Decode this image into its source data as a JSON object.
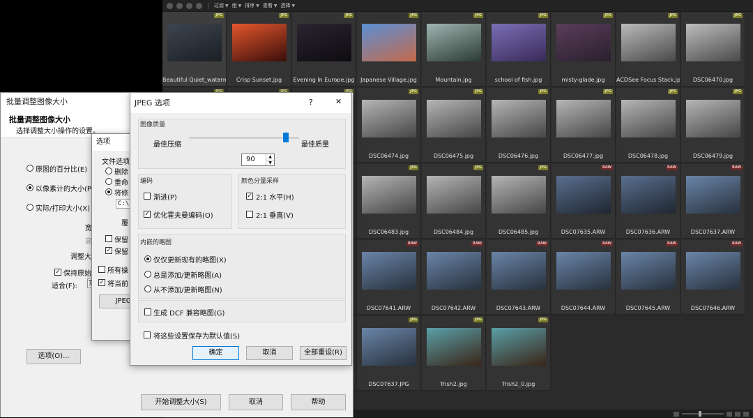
{
  "browser": {
    "toolbar": [
      "过滤",
      "组",
      "排序",
      "查看",
      "选择"
    ],
    "files": [
      {
        "name": "Beautiful Quiet_waterm...",
        "badge": "JPG",
        "c1": "#3d4550",
        "c2": "#1a1f24"
      },
      {
        "name": "Crisp Sunset.jpg",
        "badge": "JPG",
        "c1": "#e4572e",
        "c2": "#3a0e0a"
      },
      {
        "name": "Evening In Europe.jpg",
        "badge": "JPG",
        "c1": "#2a2430",
        "c2": "#0e0b10"
      },
      {
        "name": "Japanese Village.jpg",
        "badge": "JPG",
        "c1": "#5b8fd6",
        "c2": "#c46a4a"
      },
      {
        "name": "Mountain.jpg",
        "badge": "JPG",
        "c1": "#9fb4b0",
        "c2": "#2c3b34"
      },
      {
        "name": "school of fish.jpg",
        "badge": "JPG",
        "c1": "#7a6fb5",
        "c2": "#3a2a5a"
      },
      {
        "name": "misty-glade.jpg",
        "badge": "JPG",
        "c1": "#5a3e5a",
        "c2": "#2a1f2e"
      },
      {
        "name": "ACDSee Focus Stack.jpg",
        "badge": "JPG",
        "c1": "#b9b9b9",
        "c2": "#4a4a4a"
      },
      {
        "name": "DSC06470.jpg",
        "badge": "JPG",
        "c1": "#bdbdbd",
        "c2": "#4a4a4a"
      },
      {
        "name": "",
        "badge": "JPG",
        "c1": "#b5b5b5",
        "c2": "#464646"
      },
      {
        "name": "",
        "badge": "JPG",
        "c1": "#b5b5b5",
        "c2": "#464646"
      },
      {
        "name": "",
        "badge": "JPG",
        "c1": "#b5b5b5",
        "c2": "#464646"
      },
      {
        "name": "DSC06474.jpg",
        "badge": "JPG",
        "c1": "#b5b5b5",
        "c2": "#464646"
      },
      {
        "name": "DSC06475.jpg",
        "badge": "JPG",
        "c1": "#b5b5b5",
        "c2": "#464646"
      },
      {
        "name": "DSC06476.jpg",
        "badge": "JPG",
        "c1": "#b5b5b5",
        "c2": "#464646"
      },
      {
        "name": "DSC06477.jpg",
        "badge": "JPG",
        "c1": "#b5b5b5",
        "c2": "#464646"
      },
      {
        "name": "DSC06478.jpg",
        "badge": "JPG",
        "c1": "#b5b5b5",
        "c2": "#464646"
      },
      {
        "name": "DSC06479.jpg",
        "badge": "JPG",
        "c1": "#b5b5b5",
        "c2": "#464646"
      },
      {
        "name": "",
        "badge": "JPG",
        "c1": "#b5b5b5",
        "c2": "#464646"
      },
      {
        "name": "",
        "badge": "JPG",
        "c1": "#b5b5b5",
        "c2": "#464646"
      },
      {
        "name": "",
        "badge": "JPG",
        "c1": "#b5b5b5",
        "c2": "#464646"
      },
      {
        "name": "DSC06483.jpg",
        "badge": "JPG",
        "c1": "#b5b5b5",
        "c2": "#464646"
      },
      {
        "name": "DSC06484.jpg",
        "badge": "JPG",
        "c1": "#b5b5b5",
        "c2": "#464646"
      },
      {
        "name": "DSC06485.jpg",
        "badge": "JPG",
        "c1": "#b5b5b5",
        "c2": "#464646"
      },
      {
        "name": "DSC07635.ARW",
        "badge": "RAW",
        "c1": "#5a6f8f",
        "c2": "#1f2630"
      },
      {
        "name": "DSC07636.ARW",
        "badge": "RAW",
        "c1": "#5a6f8f",
        "c2": "#1f2630"
      },
      {
        "name": "DSC07637.ARW",
        "badge": "RAW",
        "c1": "#6a85a8",
        "c2": "#28313d"
      },
      {
        "name": "",
        "badge": "RAW",
        "c1": "#6a85a8",
        "c2": "#28313d"
      },
      {
        "name": "",
        "badge": "RAW",
        "c1": "#6a85a8",
        "c2": "#28313d"
      },
      {
        "name": "",
        "badge": "RAW",
        "c1": "#6a85a8",
        "c2": "#28313d"
      },
      {
        "name": "DSC07641.ARW",
        "badge": "RAW",
        "c1": "#6a85a8",
        "c2": "#28313d"
      },
      {
        "name": "DSC07642.ARW",
        "badge": "RAW",
        "c1": "#6a85a8",
        "c2": "#28313d"
      },
      {
        "name": "DSC07643.ARW",
        "badge": "RAW",
        "c1": "#6a85a8",
        "c2": "#28313d"
      },
      {
        "name": "DSC07644.ARW",
        "badge": "RAW",
        "c1": "#6a85a8",
        "c2": "#28313d"
      },
      {
        "name": "DSC07645.ARW",
        "badge": "RAW",
        "c1": "#6a85a8",
        "c2": "#28313d"
      },
      {
        "name": "DSC07646.ARW",
        "badge": "RAW",
        "c1": "#6a85a8",
        "c2": "#28313d"
      },
      {
        "name": "",
        "badge": "JPG",
        "c1": "#6a85a8",
        "c2": "#28313d"
      },
      {
        "name": "",
        "badge": "JPG",
        "c1": "#6a85a8",
        "c2": "#28313d"
      },
      {
        "name": "",
        "badge": "JPG",
        "c1": "#6a85a8",
        "c2": "#28313d"
      },
      {
        "name": "DSC07637.JPG",
        "badge": "JPG",
        "c1": "#6a85a8",
        "c2": "#28313d"
      },
      {
        "name": "Trish2.jpg",
        "badge": "JPG",
        "c1": "#5aa0a8",
        "c2": "#3a2418"
      },
      {
        "name": "Trish2_0.jpg",
        "badge": "JPG",
        "c1": "#5aa0a8",
        "c2": "#3a2418"
      }
    ]
  },
  "resize": {
    "title": "批量调整图像大小",
    "heading": "批量调整图像大小",
    "subheading": "选择调整大小操作的设置。",
    "opt_percent": "原图的百分比(E)",
    "opt_pixels": "以像素计的大小(P)",
    "opt_print": "实际/打印大小(X)",
    "width_label": "宽",
    "height_label": "高",
    "resize_label": "调整大",
    "keep_ratio": "保持原始",
    "fit_label": "适合(F):",
    "fit_value": "宽",
    "options_btn": "选项(O)...",
    "start_btn": "开始调整大小(S)",
    "cancel_btn": "取消",
    "help_btn": "帮助"
  },
  "options": {
    "title": "选项",
    "file_options": "文件选项",
    "delete": "删除",
    "rename": "重命",
    "modify": "将修",
    "path": "C:\\",
    "overwrite": "覆",
    "keep1": "保留",
    "keep2": "保留",
    "all_ops": "所有操",
    "save_current": "将当前",
    "jpeg_btn": "JPEG"
  },
  "jpeg": {
    "title": "JPEG 选项",
    "help": "?",
    "close": "✕",
    "quality_group": "图像质量",
    "best_compress": "最佳压缩",
    "best_quality": "最佳质量",
    "quality_value": "90",
    "quality_fraction": 0.88,
    "encoding_group": "编码",
    "progressive": "渐进(P)",
    "optimize": "优化霍夫曼编码(O)",
    "sampling_group": "颜色分量采样",
    "horiz": "2:1 水平(H)",
    "vert": "2:1 垂直(V)",
    "thumb_group": "内嵌的略图",
    "thumb_update": "仅仅更新现有的略图(X)",
    "thumb_always": "总是添加/更新略图(A)",
    "thumb_never": "从不添加/更新略图(N)",
    "dcf": "生成 DCF 兼容略图(G)",
    "save_default": "将这些设置保存为默认值(S)",
    "ok": "确定",
    "cancel": "取消",
    "reset": "全部重设(R)"
  }
}
